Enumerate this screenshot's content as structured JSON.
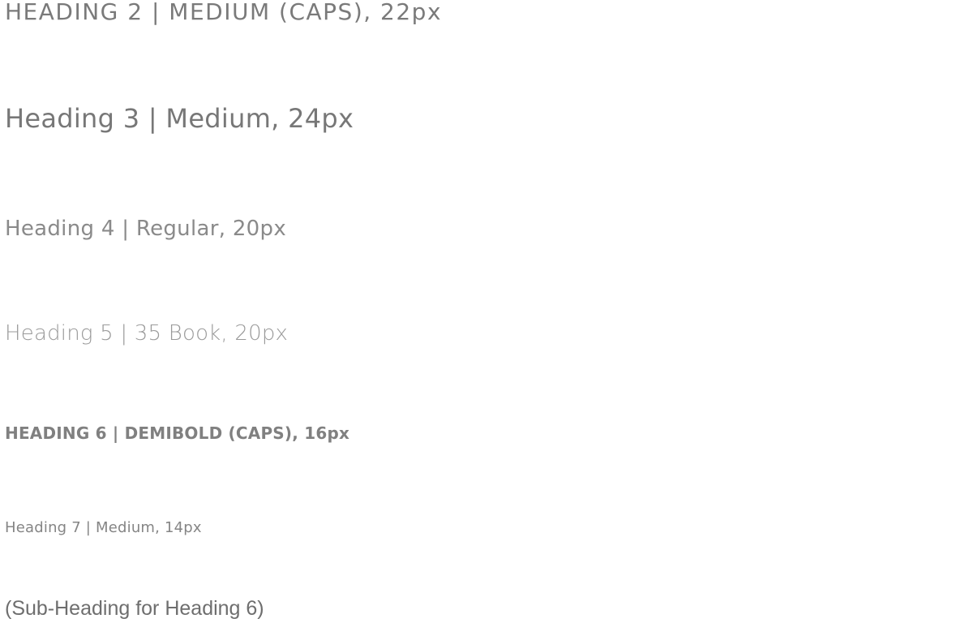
{
  "headings": {
    "heading_2": "HEADING 2 | MEDIUM (CAPS), 22px",
    "heading_3": "Heading 3 | Medium, 24px",
    "heading_4": "Heading 4 | Regular, 20px",
    "heading_5": "Heading 5 | 35 Book, 20px",
    "heading_6": "HEADING 6 | DEMIBOLD (CAPS), 16px",
    "heading_7": "Heading 7 | Medium, 14px",
    "sub_heading": "(Sub-Heading for Heading 6)"
  },
  "colors": {
    "text_gray": "#7a7a7a",
    "text_light_gray": "#9a9a9a"
  }
}
